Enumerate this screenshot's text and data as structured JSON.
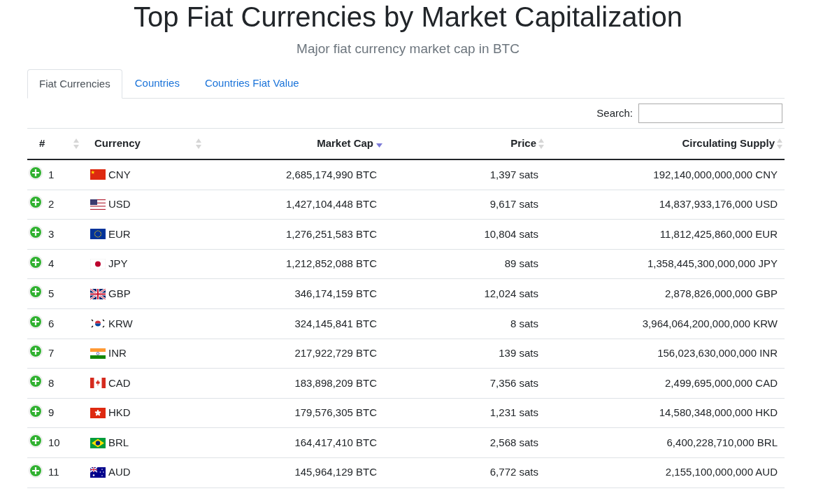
{
  "page": {
    "title": "Top Fiat Currencies by Market Capitalization",
    "subtitle": "Major fiat currency market cap in BTC"
  },
  "tabs": [
    {
      "label": "Fiat Currencies",
      "selected": true
    },
    {
      "label": "Countries",
      "selected": false
    },
    {
      "label": "Countries Fiat Value",
      "selected": false
    }
  ],
  "search": {
    "label": "Search:"
  },
  "table": {
    "columns": [
      {
        "label": "#",
        "kind": "sortable"
      },
      {
        "label": "Currency",
        "kind": "sortable"
      },
      {
        "label": "Market Cap",
        "kind": "sorted"
      },
      {
        "label": "Price",
        "kind": "sortable"
      },
      {
        "label": "Circulating Supply",
        "kind": "sortable"
      }
    ],
    "rows": [
      {
        "rank": "1",
        "kind": "cn",
        "currency": "CNY",
        "market_cap": "2,685,174,990 BTC",
        "price": "1,397 sats",
        "supply": "192,140,000,000,000 CNY"
      },
      {
        "rank": "2",
        "kind": "us",
        "currency": "USD",
        "market_cap": "1,427,104,448 BTC",
        "price": "9,617 sats",
        "supply": "14,837,933,176,000 USD"
      },
      {
        "rank": "3",
        "kind": "eu",
        "currency": "EUR",
        "market_cap": "1,276,251,583 BTC",
        "price": "10,804 sats",
        "supply": "11,812,425,860,000 EUR"
      },
      {
        "rank": "4",
        "kind": "jp",
        "currency": "JPY",
        "market_cap": "1,212,852,088 BTC",
        "price": "89 sats",
        "supply": "1,358,445,300,000,000 JPY"
      },
      {
        "rank": "5",
        "kind": "gb",
        "currency": "GBP",
        "market_cap": "346,174,159 BTC",
        "price": "12,024 sats",
        "supply": "2,878,826,000,000 GBP"
      },
      {
        "rank": "6",
        "kind": "kr",
        "currency": "KRW",
        "market_cap": "324,145,841 BTC",
        "price": "8 sats",
        "supply": "3,964,064,200,000,000 KRW"
      },
      {
        "rank": "7",
        "kind": "in",
        "currency": "INR",
        "market_cap": "217,922,729 BTC",
        "price": "139 sats",
        "supply": "156,023,630,000,000 INR"
      },
      {
        "rank": "8",
        "kind": "ca",
        "currency": "CAD",
        "market_cap": "183,898,209 BTC",
        "price": "7,356 sats",
        "supply": "2,499,695,000,000 CAD"
      },
      {
        "rank": "9",
        "kind": "hk",
        "currency": "HKD",
        "market_cap": "179,576,305 BTC",
        "price": "1,231 sats",
        "supply": "14,580,348,000,000 HKD"
      },
      {
        "rank": "10",
        "kind": "br",
        "currency": "BRL",
        "market_cap": "164,417,410 BTC",
        "price": "2,568 sats",
        "supply": "6,400,228,710,000 BRL"
      },
      {
        "rank": "11",
        "kind": "au",
        "currency": "AUD",
        "market_cap": "145,964,129 BTC",
        "price": "6,772 sats",
        "supply": "2,155,100,000,000 AUD"
      }
    ]
  }
}
